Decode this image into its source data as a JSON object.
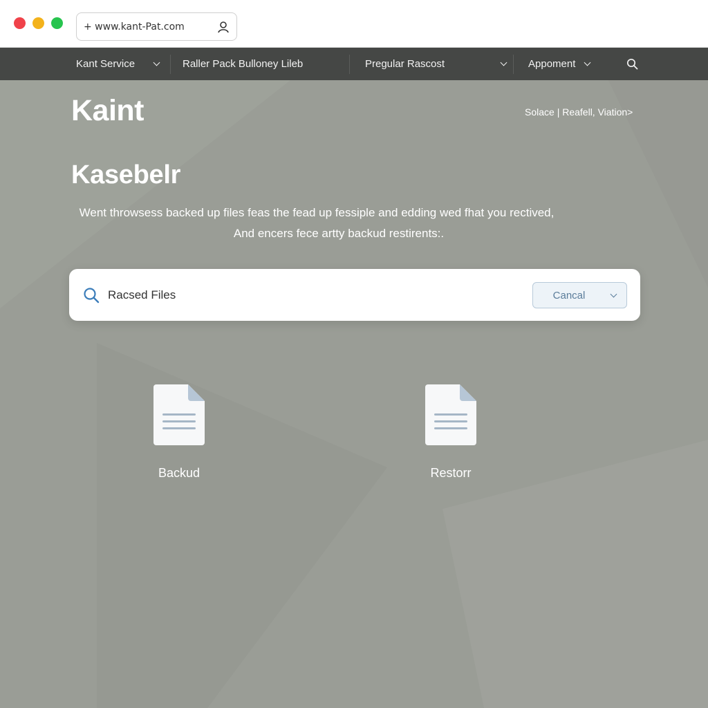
{
  "browser": {
    "url": "+ www.kant-Pat.com",
    "colors": {
      "close": "#f0424a",
      "minimize": "#f3b21b",
      "maximize": "#27c44e"
    }
  },
  "nav": {
    "items": [
      {
        "label": "Kant Service",
        "has_dropdown": true
      },
      {
        "label": "Raller Pack Bulloney Lileb",
        "has_dropdown": false
      },
      {
        "label": "Pregular Rascost",
        "has_dropdown": true
      },
      {
        "label": "Appoment",
        "has_dropdown": true
      }
    ],
    "search_icon": "search-icon"
  },
  "hero": {
    "brand": "Kaint",
    "breadcrumb": "Solace | Reafell, Viation>",
    "headline": "Kasebelr",
    "description_line1": "Went throwsess backed up files feas the fead up fessiple and edding wed fhat you rectived,",
    "description_line2": "And encers fece artty backud restirents:."
  },
  "search": {
    "value": "Racsed Files",
    "cancel_label": "Cancal",
    "accent": "#5a7c9a"
  },
  "tiles": [
    {
      "label": "Backud",
      "icon": "document-icon"
    },
    {
      "label": "Restorr",
      "icon": "document-icon"
    }
  ]
}
